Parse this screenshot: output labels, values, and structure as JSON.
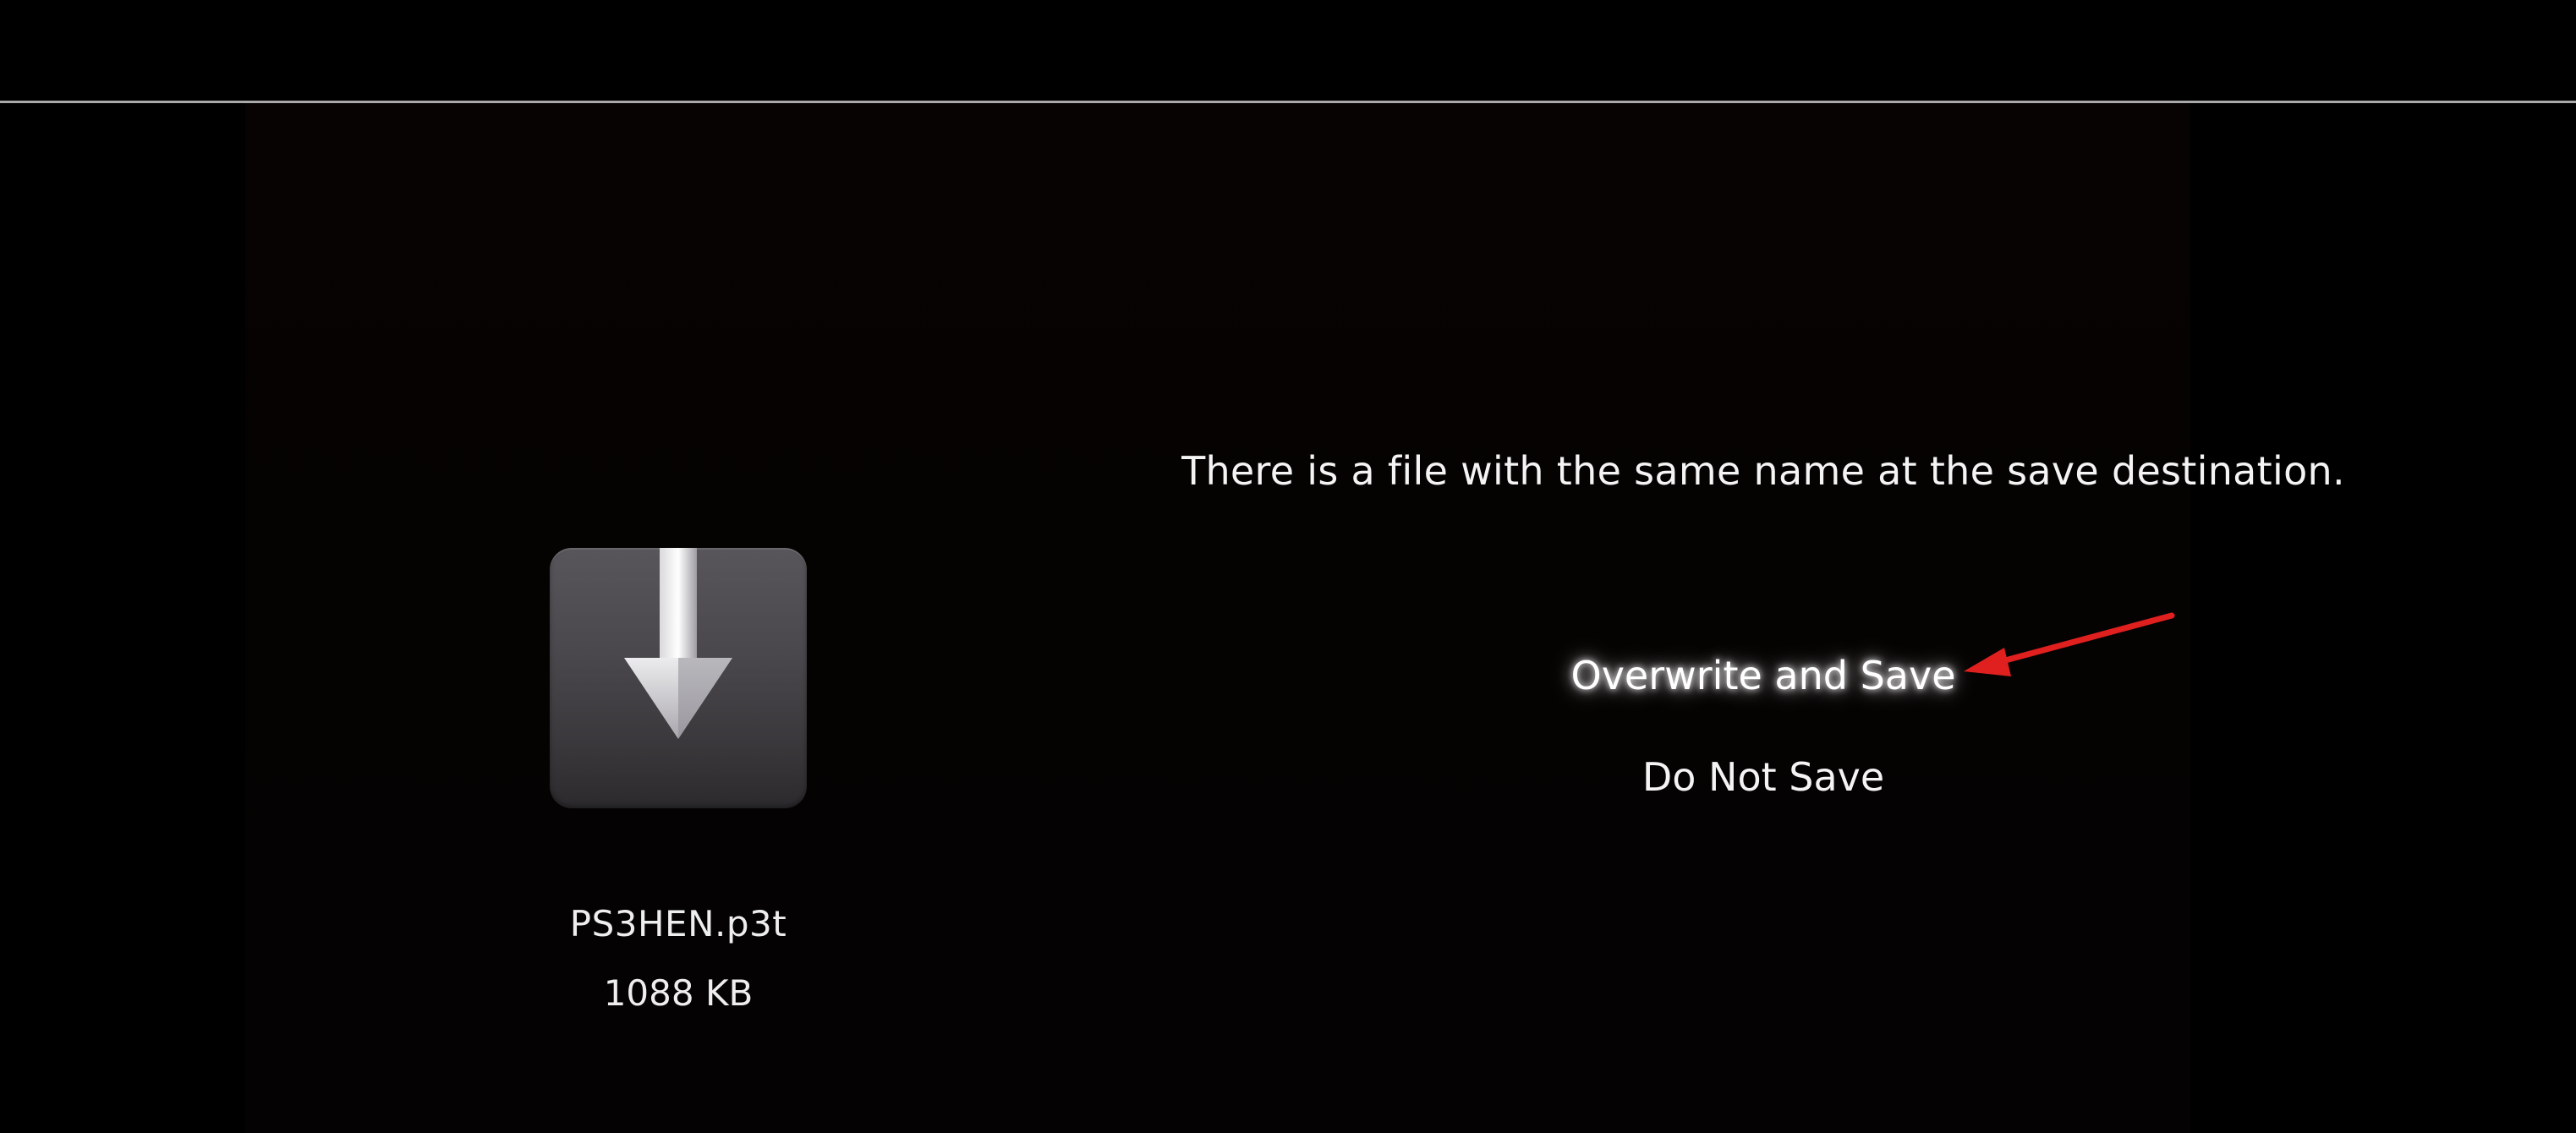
{
  "colors": {
    "background": "#000000",
    "divider": "#a9a9a9",
    "text": "#f4f4f4",
    "annotation_arrow": "#e0201e"
  },
  "file": {
    "icon": "download-arrow-icon",
    "name": "PS3HEN.p3t",
    "size": "1088 KB"
  },
  "dialog": {
    "message": "There is a file with the same name at the save destination.",
    "options": [
      {
        "label": "Overwrite and Save",
        "selected": true
      },
      {
        "label": "Do Not Save",
        "selected": false
      }
    ]
  },
  "annotation": {
    "icon": "red-pointer-arrow-icon"
  }
}
